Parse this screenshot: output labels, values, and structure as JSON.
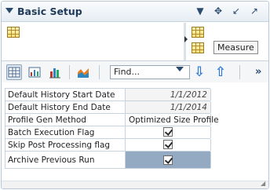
{
  "header": {
    "title": "Basic Setup",
    "icons": [
      "collapse-icon",
      "dropdown-icon",
      "move-icon",
      "minimize-icon",
      "maximize-icon"
    ]
  },
  "pivot": {
    "tooltip": "Measure"
  },
  "toolbar": {
    "find_value": "Find...",
    "icons": [
      "grid-view-icon",
      "chart-table-icon",
      "bar-chart-icon",
      "area-chart-icon",
      "find-next-icon",
      "find-previous-icon",
      "overflow-icon"
    ]
  },
  "table": {
    "rows": [
      {
        "label": "Default History Start Date",
        "value": "1/1/2012",
        "kind": "date"
      },
      {
        "label": "Default History End Date",
        "value": "1/1/2014",
        "kind": "date"
      },
      {
        "label": "Profile Gen Method",
        "value": "Optimized Size Profile",
        "kind": "text"
      },
      {
        "label": "Batch Execution Flag",
        "checked": true,
        "kind": "checkbox"
      },
      {
        "label": "Skip Post Processing flag",
        "checked": true,
        "kind": "checkbox"
      },
      {
        "label": "Archive Previous Run",
        "checked": true,
        "kind": "checkbox"
      }
    ]
  },
  "colors": {
    "accent": "#2f7bd8",
    "header_text": "#1f3a5a",
    "selection": "#94a9c2"
  }
}
